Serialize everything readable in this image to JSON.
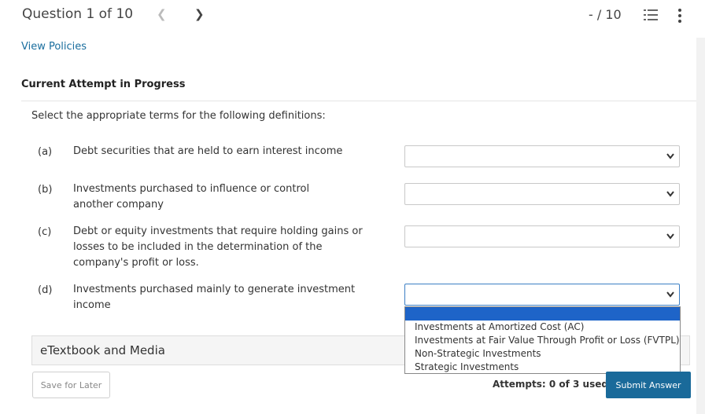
{
  "header": {
    "question_counter": "Question 1 of 10",
    "prev_icon": "chevron-left-icon",
    "next_icon": "chevron-right-icon",
    "score": "- / 10",
    "list_icon": "numbered-list-icon",
    "menu_icon": "kebab-menu-icon"
  },
  "links": {
    "view_policies": "View Policies"
  },
  "attempt_heading": "Current Attempt in Progress",
  "instructions": "Select the appropriate terms for the following definitions:",
  "questions": [
    {
      "letter": "(a)",
      "definition": "Debt securities that are held to earn interest income",
      "selected": ""
    },
    {
      "letter": "(b)",
      "definition": "Investments purchased to influence or control another company",
      "selected": ""
    },
    {
      "letter": "(c)",
      "definition": "Debt or equity investments that require holding gains or losses to be included in the determination of the company's profit or loss.",
      "selected": ""
    },
    {
      "letter": "(d)",
      "definition": "Investments purchased mainly to generate investment income",
      "selected": ""
    }
  ],
  "dropdown_options": [
    "",
    "Investments at Amortized Cost (AC)",
    "Investments at Fair Value Through Profit or Loss (FVTPL)",
    "Non-Strategic Investments",
    "Strategic Investments"
  ],
  "etextbook": {
    "label": "eTextbook and Media"
  },
  "footer": {
    "save_label": "Save for Later",
    "attempts_text": "Attempts: 0 of 3 used",
    "submit_label": "Submit Answer"
  },
  "colors": {
    "link": "#1a6e9e",
    "submit_bg": "#1a6a9a",
    "highlight": "#1e64c8",
    "focus_border": "#3b7fc4"
  }
}
